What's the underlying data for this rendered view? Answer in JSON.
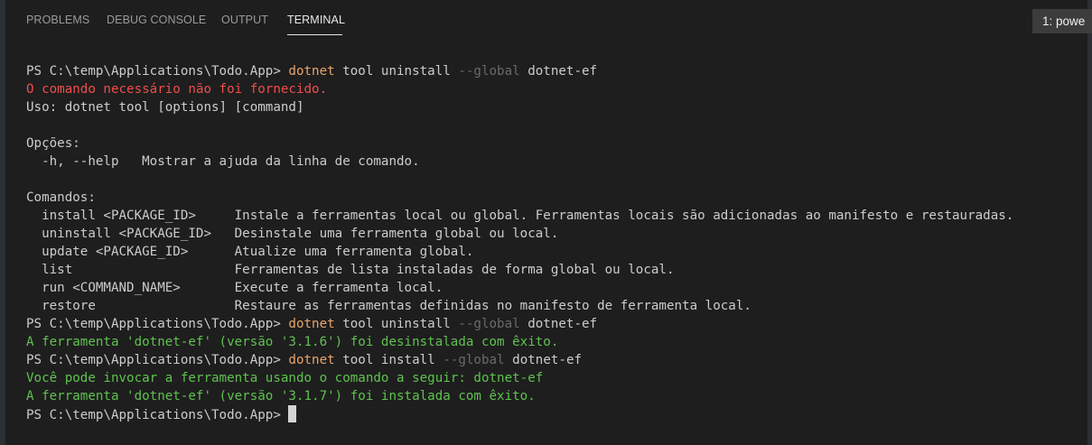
{
  "tabs": [
    {
      "label": "PROBLEMS",
      "active": false
    },
    {
      "label": "DEBUG CONSOLE",
      "active": false
    },
    {
      "label": "OUTPUT",
      "active": false
    },
    {
      "label": "TERMINAL",
      "active": true
    }
  ],
  "terminal_selector": {
    "label": "1: powe"
  },
  "colors": {
    "panel_bg": "#1e1e1e",
    "command": "#e9a56a",
    "flag": "#6a6a6a",
    "error": "#f14c4c",
    "success": "#5fc24f",
    "text": "#cccccc"
  },
  "terminal": {
    "lines": [
      {
        "kind": "prompt",
        "prompt": "PS C:\\temp\\Applications\\Todo.App> ",
        "cmd": "dotnet",
        "a": " tool uninstall ",
        "flag": "--global",
        "b": " dotnet-ef"
      },
      {
        "kind": "error",
        "text": "O comando necessário não foi fornecido."
      },
      {
        "kind": "plain",
        "text": "Uso: dotnet tool [options] [command]"
      },
      {
        "kind": "plain",
        "text": ""
      },
      {
        "kind": "plain",
        "text": "Opções:"
      },
      {
        "kind": "plain",
        "text": "  -h, --help   Mostrar a ajuda da linha de comando."
      },
      {
        "kind": "plain",
        "text": ""
      },
      {
        "kind": "plain",
        "text": "Comandos:"
      },
      {
        "kind": "plain",
        "text": "  install <PACKAGE_ID>     Instale a ferramentas local ou global. Ferramentas locais são adicionadas ao manifesto e restauradas."
      },
      {
        "kind": "plain",
        "text": "  uninstall <PACKAGE_ID>   Desinstale uma ferramenta global ou local."
      },
      {
        "kind": "plain",
        "text": "  update <PACKAGE_ID>      Atualize uma ferramenta global."
      },
      {
        "kind": "plain",
        "text": "  list                     Ferramentas de lista instaladas de forma global ou local."
      },
      {
        "kind": "plain",
        "text": "  run <COMMAND_NAME>       Execute a ferramenta local."
      },
      {
        "kind": "plain",
        "text": "  restore                  Restaure as ferramentas definidas no manifesto de ferramenta local."
      },
      {
        "kind": "prompt",
        "prompt": "PS C:\\temp\\Applications\\Todo.App> ",
        "cmd": "dotnet",
        "a": " tool uninstall ",
        "flag": "--global",
        "b": " dotnet-ef"
      },
      {
        "kind": "success",
        "text": "A ferramenta 'dotnet-ef' (versão '3.1.6') foi desinstalada com êxito."
      },
      {
        "kind": "prompt",
        "prompt": "PS C:\\temp\\Applications\\Todo.App> ",
        "cmd": "dotnet",
        "a": " tool install ",
        "flag": "--global",
        "b": " dotnet-ef"
      },
      {
        "kind": "success",
        "text": "Você pode invocar a ferramenta usando o comando a seguir: dotnet-ef"
      },
      {
        "kind": "success",
        "text": "A ferramenta 'dotnet-ef' (versão '3.1.7') foi instalada com êxito."
      },
      {
        "kind": "cursor",
        "prompt": "PS C:\\temp\\Applications\\Todo.App> "
      }
    ]
  }
}
